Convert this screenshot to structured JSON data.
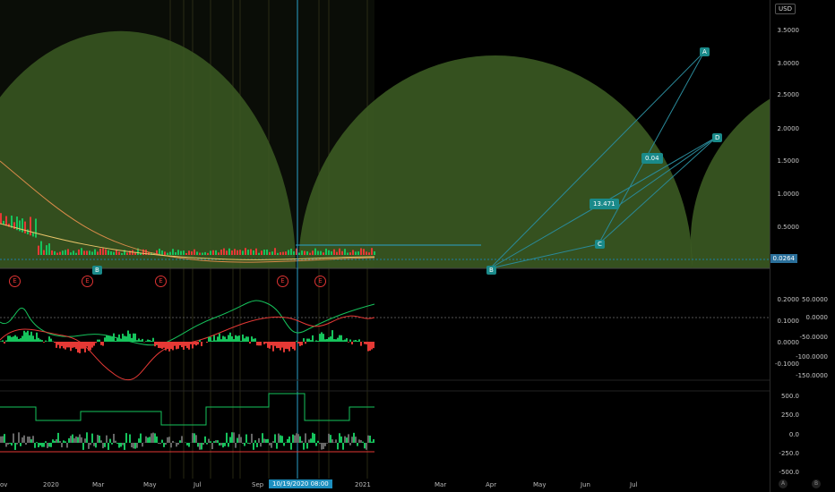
{
  "currency": "USD",
  "current_price": "0.0264",
  "main_axis": [
    "3.5000",
    "3.0000",
    "2.5000",
    "2.0000",
    "1.5000",
    "1.0000",
    "0.5000"
  ],
  "osc_axis_left": [
    "0.2000",
    "0.1000",
    "0.0000",
    "-0.1000"
  ],
  "osc_axis_right": [
    "50.0000",
    "0.0000",
    "-50.0000",
    "-100.0000",
    "-150.0000"
  ],
  "bottom_axis": [
    "500.0",
    "250.0",
    "0.0",
    "-250.0",
    "-500.0"
  ],
  "x_axis": {
    "left": "ov",
    "labels": [
      "2020",
      "Mar",
      "May",
      "Jul",
      "Sep",
      "2021",
      "Mar",
      "Apr",
      "May",
      "Jun",
      "Jul"
    ]
  },
  "crosshair_time": "10/19/2020   08:00",
  "points": {
    "A": "A",
    "B": "B",
    "C": "C",
    "D": "D",
    "B2": "B"
  },
  "values": {
    "v1": "0.04",
    "v2": "13.471"
  },
  "earnings": "E",
  "nums": [
    "2",
    "3",
    "15",
    "1",
    "5",
    "4",
    "6",
    "3",
    "2",
    "2",
    "15",
    "3",
    "3",
    "4",
    "98",
    "2",
    "3",
    "4",
    "5",
    "16",
    "9",
    "1",
    "24",
    "65",
    "3",
    "97",
    "35",
    "36",
    "2",
    "5",
    "96"
  ],
  "corner": {
    "a": "A",
    "b": "B"
  },
  "colors": {
    "arc": "#3b5a22",
    "up": "#16c35c",
    "down": "#e53935",
    "line": "#2aa1c9"
  }
}
